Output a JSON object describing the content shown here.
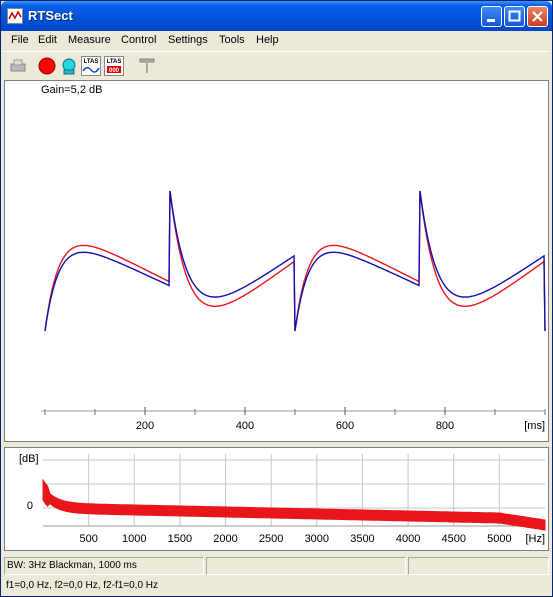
{
  "window": {
    "title": "RTSect"
  },
  "menu": [
    "File",
    "Edit",
    "Measure",
    "Control",
    "Settings",
    "Tools",
    "Help"
  ],
  "toolbar": {
    "ltas1": "LTAS",
    "ltas2": "LTAS",
    "ltas2_sub": "000"
  },
  "waveform": {
    "gain_label": "Gain=5,2 dB",
    "x_ticks": [
      "200",
      "400",
      "600",
      "800"
    ],
    "x_unit": "[ms]",
    "colors": {
      "series_a": "#E8161B",
      "series_b": "#1010B0"
    }
  },
  "spectrum": {
    "y_unit": "[dB]",
    "y_tick": "0",
    "x_ticks": [
      "500",
      "1000",
      "1500",
      "2000",
      "2500",
      "3000",
      "3500",
      "4000",
      "4500",
      "5000"
    ],
    "x_unit": "[Hz]",
    "color": "#E8161B"
  },
  "status": {
    "line1": "BW: 3Hz Blackman, 1000 ms",
    "line2": "f1=0,0 Hz, f2=0,0 Hz, f2-f1=0,0 Hz"
  }
}
